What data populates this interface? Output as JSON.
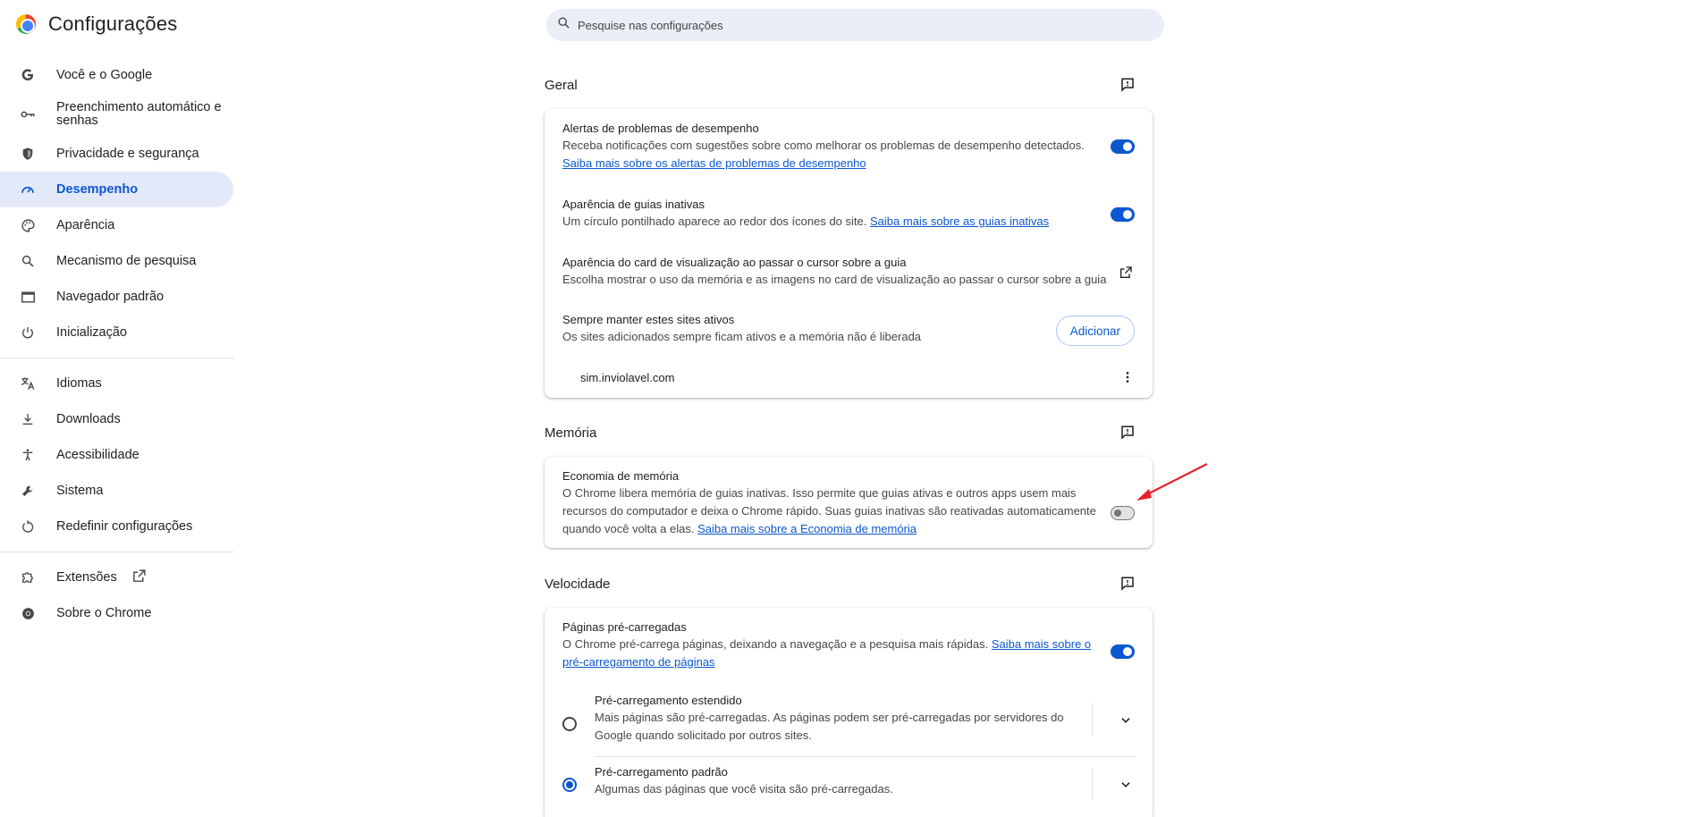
{
  "header": {
    "title": "Configurações",
    "search_placeholder": "Pesquise nas configurações"
  },
  "sidebar": {
    "items": [
      {
        "label": "Você e o Google",
        "icon": "google-g-icon"
      },
      {
        "label": "Preenchimento automático e senhas",
        "icon": "key-icon"
      },
      {
        "label": "Privacidade e segurança",
        "icon": "shield-icon"
      },
      {
        "label": "Desempenho",
        "icon": "speedometer-icon",
        "active": true
      },
      {
        "label": "Aparência",
        "icon": "palette-icon"
      },
      {
        "label": "Mecanismo de pesquisa",
        "icon": "search-icon"
      },
      {
        "label": "Navegador padrão",
        "icon": "browser-window-icon"
      },
      {
        "label": "Inicialização",
        "icon": "power-icon"
      },
      {
        "label": "Idiomas",
        "icon": "translate-icon"
      },
      {
        "label": "Downloads",
        "icon": "download-icon"
      },
      {
        "label": "Acessibilidade",
        "icon": "accessibility-icon"
      },
      {
        "label": "Sistema",
        "icon": "wrench-icon"
      },
      {
        "label": "Redefinir configurações",
        "icon": "reset-icon"
      },
      {
        "label": "Extensões",
        "icon": "puzzle-icon"
      },
      {
        "label": "Sobre o Chrome",
        "icon": "chrome-icon"
      }
    ]
  },
  "geral": {
    "title": "Geral",
    "alerts": {
      "title": "Alertas de problemas de desempenho",
      "desc": "Receba notificações com sugestões sobre como melhorar os problemas de desempenho detectados.",
      "link": "Saiba mais sobre os alertas de problemas de desempenho",
      "enabled": true
    },
    "inactive_tabs": {
      "title": "Aparência de guias inativas",
      "desc": "Um círculo pontilhado aparece ao redor dos ícones do site.",
      "link": "Saiba mais sobre as guias inativas",
      "enabled": true
    },
    "hover_card": {
      "title": "Aparência do card de visualização ao passar o cursor sobre a guia",
      "desc": "Escolha mostrar o uso da memória e as imagens no card de visualização ao passar o cursor sobre a guia"
    },
    "always_active": {
      "title": "Sempre manter estes sites ativos",
      "desc": "Os sites adicionados sempre ficam ativos e a memória não é liberada",
      "button": "Adicionar",
      "site": "sim.inviolavel.com"
    }
  },
  "memoria": {
    "title": "Memória",
    "saver": {
      "title": "Economia de memória",
      "desc_line1": "O Chrome libera memória de guias inativas. Isso permite que guias ativas e outros apps usem mais",
      "desc_line2": "recursos do computador e deixa o Chrome rápido. Suas guias inativas são reativadas automaticamente",
      "desc_line3": "quando você volta a elas.",
      "link": "Saiba mais sobre a Economia de memória",
      "enabled": false
    }
  },
  "velocidade": {
    "title": "Velocidade",
    "preload": {
      "title": "Páginas pré-carregadas",
      "desc": "O Chrome pré-carrega páginas, deixando a navegação e a pesquisa mais rápidas.",
      "link_part1": "Saiba mais sobre o",
      "link_part2": "pré-carregamento de páginas",
      "enabled": true
    },
    "extended": {
      "title": "Pré-carregamento estendido",
      "desc_line1": "Mais páginas são pré-carregadas. As páginas podem ser pré-carregadas por servidores do",
      "desc_line2": "Google quando solicitado por outros sites.",
      "selected": false
    },
    "standard": {
      "title": "Pré-carregamento padrão",
      "desc": "Algumas das páginas que você visita são pré-carregadas.",
      "selected": true
    }
  },
  "colors": {
    "accent": "#0b57d0",
    "active_nav_bg": "#e3e9f8",
    "annotation_arrow": "#e8212a"
  }
}
